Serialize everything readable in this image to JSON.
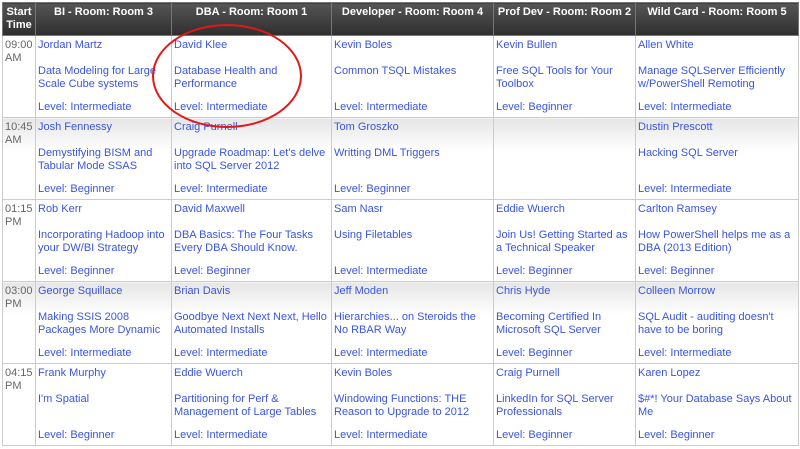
{
  "headers": [
    "Start Time",
    "BI - Room: Room 3",
    "DBA - Room: Room 1",
    "Developer - Room: Room 4",
    "Prof Dev - Room: Room 2",
    "Wild Card - Room: Room 5"
  ],
  "rows": [
    {
      "time": "09:00 AM",
      "sessions": [
        {
          "speaker": "Jordan Martz",
          "title": "Data Modeling for Large Scale Cube systems",
          "level": "Level: Intermediate"
        },
        {
          "speaker": "David Klee",
          "title": "Database Health and Performance",
          "level": "Level: Intermediate"
        },
        {
          "speaker": "Kevin Boles",
          "title": "Common TSQL Mistakes",
          "level": "Level: Intermediate"
        },
        {
          "speaker": "Kevin Bullen",
          "title": "Free SQL Tools for Your Toolbox",
          "level": "Level: Beginner"
        },
        {
          "speaker": "Allen White",
          "title": "Manage SQLServer Efficiently w/PowerShell Remoting",
          "level": "Level: Intermediate"
        }
      ]
    },
    {
      "time": "10:45 AM",
      "sessions": [
        {
          "speaker": "Josh Fennessy",
          "title": "Demystifying BISM and Tabular Mode SSAS",
          "level": "Level: Beginner"
        },
        {
          "speaker": "Craig Purnell",
          "title": "Upgrade Roadmap: Let's delve into SQL Server 2012",
          "level": "Level: Intermediate"
        },
        {
          "speaker": "Tom Groszko",
          "title": "Writting DML Triggers",
          "level": "Level: Beginner"
        },
        null,
        {
          "speaker": "Dustin Prescott",
          "title": "Hacking SQL Server",
          "level": "Level: Intermediate"
        }
      ]
    },
    {
      "time": "01:15 PM",
      "sessions": [
        {
          "speaker": "Rob Kerr",
          "title": "Incorporating Hadoop into your DW/BI Strategy",
          "level": "Level: Beginner"
        },
        {
          "speaker": "David Maxwell",
          "title": "DBA Basics: The Four Tasks Every DBA Should Know.",
          "level": "Level: Beginner"
        },
        {
          "speaker": "Sam Nasr",
          "title": "Using Filetables",
          "level": "Level: Intermediate"
        },
        {
          "speaker": "Eddie Wuerch",
          "title": "Join Us! Getting Started as a Technical Speaker",
          "level": "Level: Beginner"
        },
        {
          "speaker": "Carlton Ramsey",
          "title": "How PowerShell helps me as a DBA (2013 Edition)",
          "level": "Level: Beginner"
        }
      ]
    },
    {
      "time": "03:00 PM",
      "sessions": [
        {
          "speaker": "George Squillace",
          "title": "Making SSIS 2008 Packages More Dynamic",
          "level": "Level: Intermediate"
        },
        {
          "speaker": "Brian Davis",
          "title": "Goodbye Next Next Next, Hello Automated Installs",
          "level": "Level: Intermediate"
        },
        {
          "speaker": "Jeff Moden",
          "title": "Hierarchies... on Steroids the No RBAR Way",
          "level": "Level: Intermediate"
        },
        {
          "speaker": "Chris Hyde",
          "title": "Becoming Certified In Microsoft SQL Server",
          "level": "Level: Beginner"
        },
        {
          "speaker": "Colleen Morrow",
          "title": "SQL Audit - auditing doesn't have to be boring",
          "level": "Level: Intermediate"
        }
      ]
    },
    {
      "time": "04:15 PM",
      "sessions": [
        {
          "speaker": "Frank Murphy",
          "title": "I'm Spatial",
          "level": "Level: Beginner"
        },
        {
          "speaker": "Eddie Wuerch",
          "title": "Partitioning for Perf & Management of Large Tables",
          "level": "Level: Intermediate"
        },
        {
          "speaker": "Kevin Boles",
          "title": "Windowing Functions: THE Reason to Upgrade to 2012",
          "level": "Level: Intermediate"
        },
        {
          "speaker": "Craig Purnell",
          "title": "LinkedIn for SQL Server Professionals",
          "level": "Level: Beginner"
        },
        {
          "speaker": "Karen Lopez",
          "title": "$#*! Your Database Says About Me",
          "level": "Level: Beginner"
        }
      ]
    }
  ]
}
